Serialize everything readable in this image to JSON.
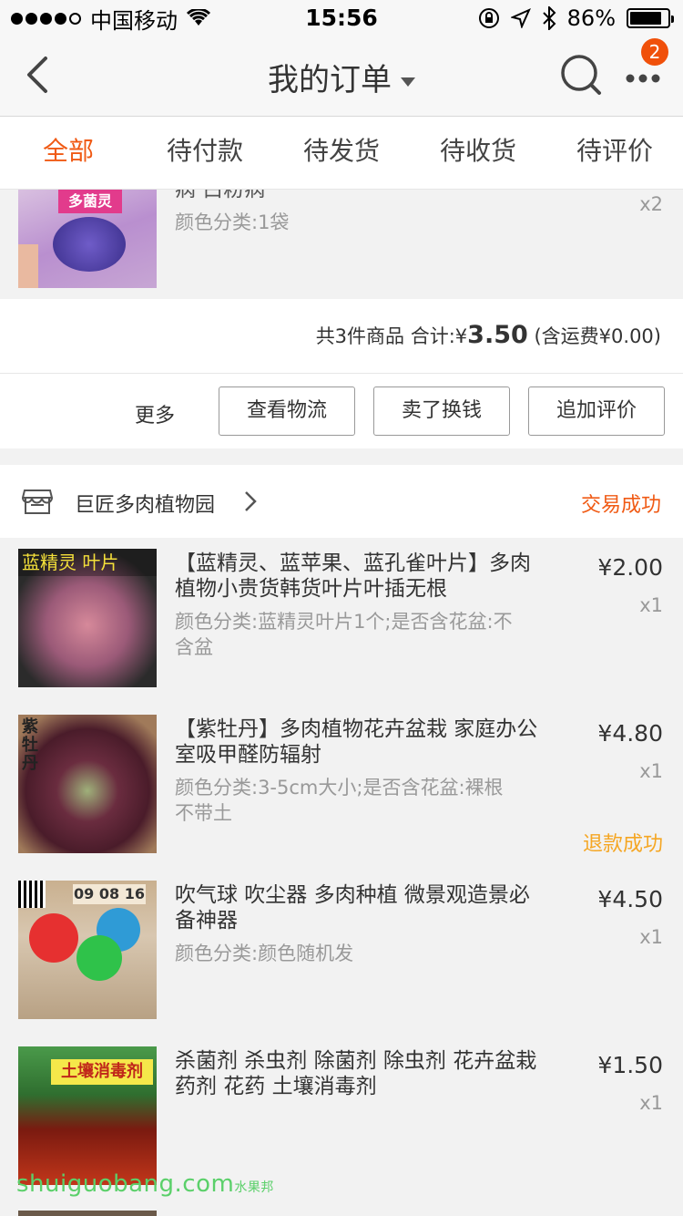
{
  "status_bar": {
    "carrier": "中国移动",
    "time": "15:56",
    "battery": "86%",
    "battery_level": 0.86
  },
  "nav": {
    "title": "我的订单",
    "badge_count": "2"
  },
  "tabs": [
    {
      "label": "全部",
      "active": true
    },
    {
      "label": "待付款"
    },
    {
      "label": "待发货"
    },
    {
      "label": "待收货"
    },
    {
      "label": "待评价"
    }
  ],
  "prev_order": {
    "partial_title": "病 白粉病",
    "thumb_text": "多菌灵",
    "spec": "颜色分类:1袋",
    "qty": "x2",
    "summary": {
      "count_text": "共3件商品 合计:¥",
      "total": "3.50",
      "shipping": "(含运费¥0.00)"
    },
    "actions": {
      "more": "更多",
      "logistics": "查看物流",
      "resell": "卖了换钱",
      "review": "追加评价"
    }
  },
  "order": {
    "shop_name": "巨匠多肉植物园",
    "status": "交易成功",
    "items": [
      {
        "title": "【蓝精灵、蓝苹果、蓝孔雀叶片】多肉植物小贵货韩货叶片叶插无根",
        "spec": "颜色分类:蓝精灵叶片1个;是否含花盆:不含盆",
        "price": "¥2.00",
        "qty": "x1",
        "thumb_text": "蓝精灵 叶片"
      },
      {
        "title": "【紫牡丹】多肉植物花卉盆栽 家庭办公室吸甲醛防辐射",
        "spec": "颜色分类:3-5cm大小;是否含花盆:裸根不带土",
        "price": "¥4.80",
        "qty": "x1",
        "refund": "退款成功",
        "thumb_text": "紫牡丹"
      },
      {
        "title": "吹气球 吹尘器 多肉种植 微景观造景必备神器",
        "spec": "颜色分类:颜色随机发",
        "price": "¥4.50",
        "qty": "x1",
        "thumb_text": "09 08 16"
      },
      {
        "title": "杀菌剂 杀虫剂 除菌剂 除虫剂 花卉盆栽药剂 花药 土壤消毒剂",
        "spec": "",
        "price": "¥1.50",
        "qty": "x1",
        "thumb_text": "土壤消毒剂"
      }
    ]
  },
  "watermark": {
    "text": "shuiguobang.com",
    "cn": "水果邦"
  },
  "colors": {
    "accent": "#f05a14",
    "refund": "#f5a623",
    "badge": "#f0500a"
  }
}
